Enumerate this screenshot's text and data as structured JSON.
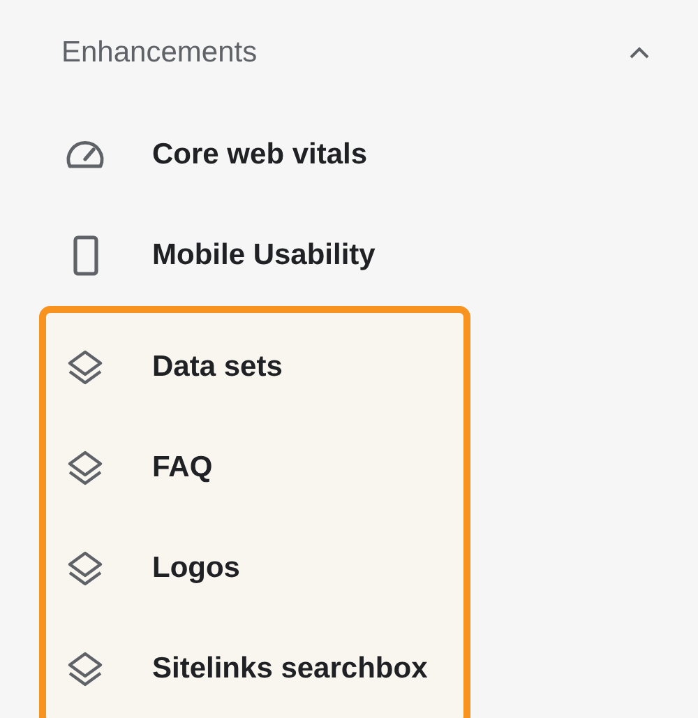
{
  "section": {
    "title": "Enhancements",
    "expanded": true
  },
  "items": [
    {
      "label": "Core web vitals",
      "kind": "gauge"
    },
    {
      "label": "Mobile Usability",
      "kind": "phone"
    }
  ],
  "highlighted_items": [
    {
      "label": "Data sets",
      "kind": "layers"
    },
    {
      "label": "FAQ",
      "kind": "layers"
    },
    {
      "label": "Logos",
      "kind": "layers"
    },
    {
      "label": "Sitelinks searchbox",
      "kind": "layers"
    }
  ]
}
